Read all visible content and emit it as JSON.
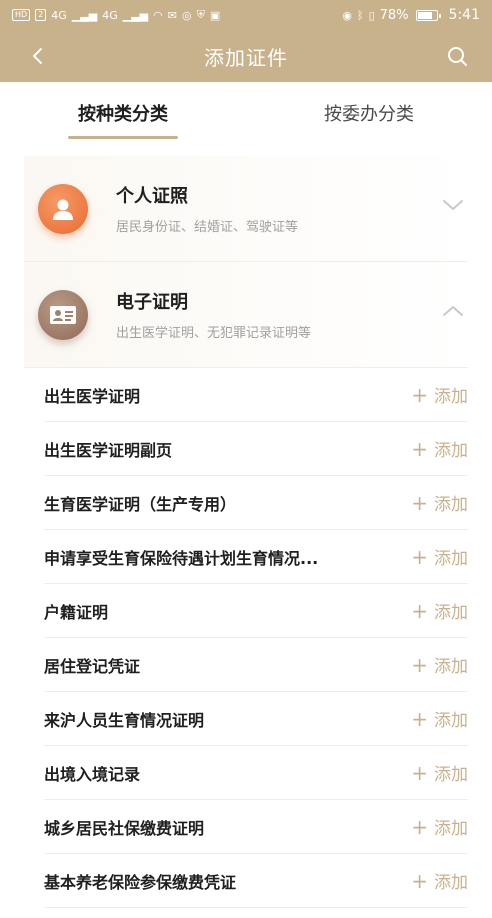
{
  "status_bar": {
    "left_badges": [
      "HD",
      "2",
      "4G",
      "4G"
    ],
    "battery_percent": "78%",
    "battery_level": 0.78,
    "time": "5:41"
  },
  "nav": {
    "title": "添加证件",
    "back_icon": "chevron-left-icon",
    "search_icon": "search-icon"
  },
  "tabs": [
    {
      "label": "按种类分类",
      "active": true
    },
    {
      "label": "按委办分类",
      "active": false
    }
  ],
  "groups": [
    {
      "title": "个人证照",
      "desc": "居民身份证、结婚证、驾驶证等",
      "expanded": false,
      "icon": "person-icon"
    },
    {
      "title": "电子证明",
      "desc": "出生医学证明、无犯罪记录证明等",
      "expanded": true,
      "icon": "id-card-icon"
    }
  ],
  "add_label": "添加",
  "items": [
    "出生医学证明",
    "出生医学证明副页",
    "生育医学证明（生产专用）",
    "申请享受生育保险待遇计划生育情况...",
    "户籍证明",
    "居住登记凭证",
    "来沪人员生育情况证明",
    "出境入境记录",
    "城乡居民社保缴费证明",
    "基本养老保险参保缴费凭证"
  ],
  "colors": {
    "accent": "#c8b28c",
    "avatar_orange": "#e96b30",
    "avatar_brown": "#8f6b58"
  }
}
